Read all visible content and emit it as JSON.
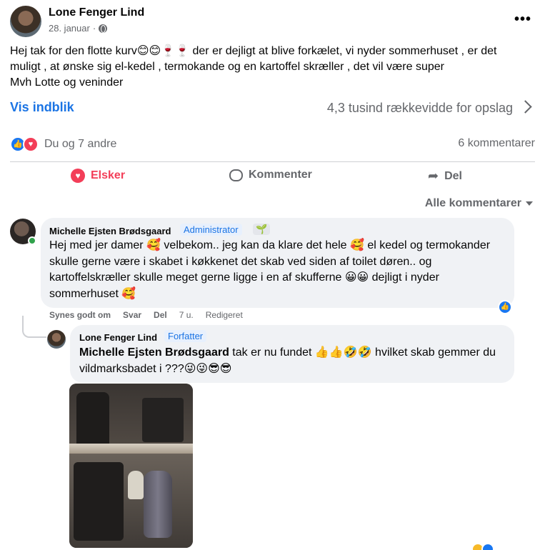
{
  "post": {
    "author": "Lone Fenger Lind",
    "date": "28. januar",
    "separator": "·",
    "more_label": "•••",
    "text_line1": "Hej tak  for den flotte kurv😊😊🍷🍷 der er dejligt at blive forkælet, vi nyder sommerhuset , er det",
    "text_line2": "muligt , at ønske sig el-kedel , termokande og en kartoffel skræller , det vil være super",
    "text_line3": "Mvh Lotte og veninder"
  },
  "insights": {
    "link_label": "Vis indblik",
    "reach_text": "4,3 tusind rækkevidde for opslag"
  },
  "reactions": {
    "summary": "Du og 7 andre",
    "comment_count": "6 kommentarer"
  },
  "actions": {
    "love_label": "Elsker",
    "comment_label": "Kommenter",
    "share_label": "Del"
  },
  "comments_filter": "Alle kommentarer",
  "comments": [
    {
      "author": "Michelle Ejsten Brødsgaard",
      "badge": "Administrator",
      "badge2": "🌱",
      "line1": "Hej med jer damer 🥰 velbekom.. jeg kan da klare det hele 🥰 el kedel og termokander",
      "line2": "skulle gerne være i skabet i køkkenet det skab ved siden af toilet døren.. og",
      "line3": "kartoffelskræller skulle meget gerne ligge i en af skufferne 😀😀 dejligt i nyder",
      "line4": "sommerhuset 🥰",
      "like_label": "Synes godt om",
      "reply_label": "Svar",
      "delete_label": "Del",
      "time": "7 u.",
      "edited": "Redigeret"
    },
    {
      "author": "Lone Fenger Lind",
      "badge": "Forfatter",
      "mention": "Michelle Ejsten Brødsgaard",
      "line1_rest": " tak er nu fundet 👍👍🤣🤣 hvilket skab gemmer du",
      "line2": "vildmarksbadet i ???😜😜😎😎"
    }
  ],
  "icons": {
    "globe": "globe-icon",
    "like": "like-icon",
    "love": "love-icon",
    "comment": "comment-bubble-icon",
    "share": "share-arrow-icon",
    "chevron": "chevron-right-icon",
    "dropdown": "caret-down-icon"
  },
  "colors": {
    "accent": "#1b74e4",
    "love": "#f33e58",
    "like": "#1877f2",
    "muted": "#65676b",
    "bubble": "#f0f2f5"
  }
}
